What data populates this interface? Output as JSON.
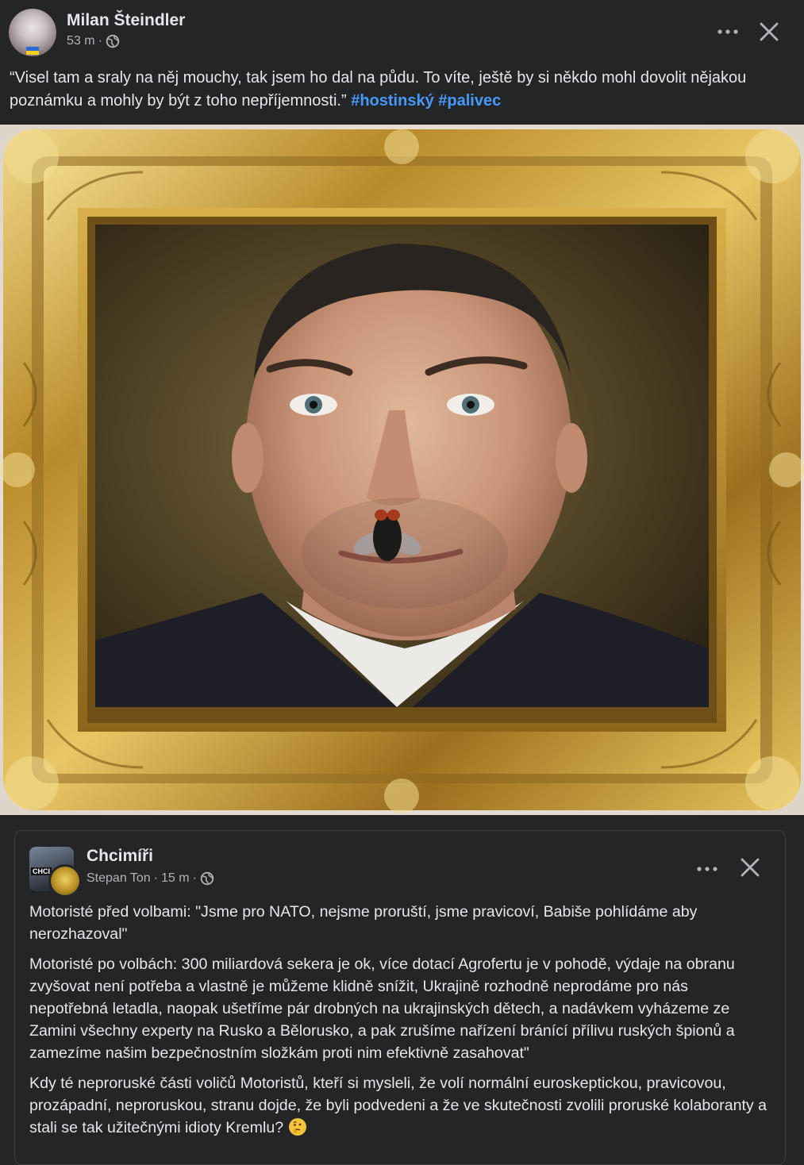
{
  "post": {
    "author": "Milan Šteindler",
    "time": "53 m",
    "separator": "·",
    "audience_icon": "globe-icon",
    "more_icon": "more-options-icon",
    "close_icon": "close-icon",
    "text": "“Visel tam a sraly na něj mouchy, tak jsem ho dal na půdu. To víte, ještě by si někdo mohl dovolit nějakou poznámku a mohly by být z toho nepříjemnosti.”",
    "hashtags": [
      "#hostinský",
      "#palivec"
    ]
  },
  "photo": {
    "subject": "framed-portrait-with-fly"
  },
  "shared_post": {
    "page_name": "Chcimíři",
    "author": "Stepan Ton",
    "time": "15 m",
    "separator": "·",
    "avatar_label": "CHCI",
    "paragraphs": [
      "Motoristé před volbami: \"Jsme pro NATO, nejsme proruští, jsme pravicoví, Babiše pohlídáme aby nerozhazoval\"",
      "Motoristé po volbách: 300 miliardová sekera je ok, více dotací Agrofertu je v pohodě, výdaje na obranu zvyšovat není potřeba a vlastně je můžeme klidně snížit, Ukrajině rozhodně neprodáme pro nás nepotřebná letadla, naopak ušetříme pár drobných na ukrajinských dětech, a nadávkem vyházeme ze Zamini všechny experty na Rusko a Bělorusko, a pak zrušíme nařízení bránící přílivu ruských špionů a zamezíme našim bezpečnostním složkám proti nim efektivně zasahovat\"",
      "Kdy té neproruské části voličů Motoristů, kteří si mysleli, že volí normální euroskeptickou, pravicovou, prozápadní, neproruskou, stranu dojde, že byli podvedeni a že ve skutečnosti zvolili proruské kolaboranty a stali se tak užitečnými idioty Kremlu?"
    ],
    "end_emoji": "thinking-face-emoji"
  },
  "colors": {
    "background": "#242526",
    "text": "#e4e6eb",
    "secondary_text": "#b0b3b8",
    "hashtag": "#4599ff",
    "frame_gold": "#c9a23a"
  }
}
